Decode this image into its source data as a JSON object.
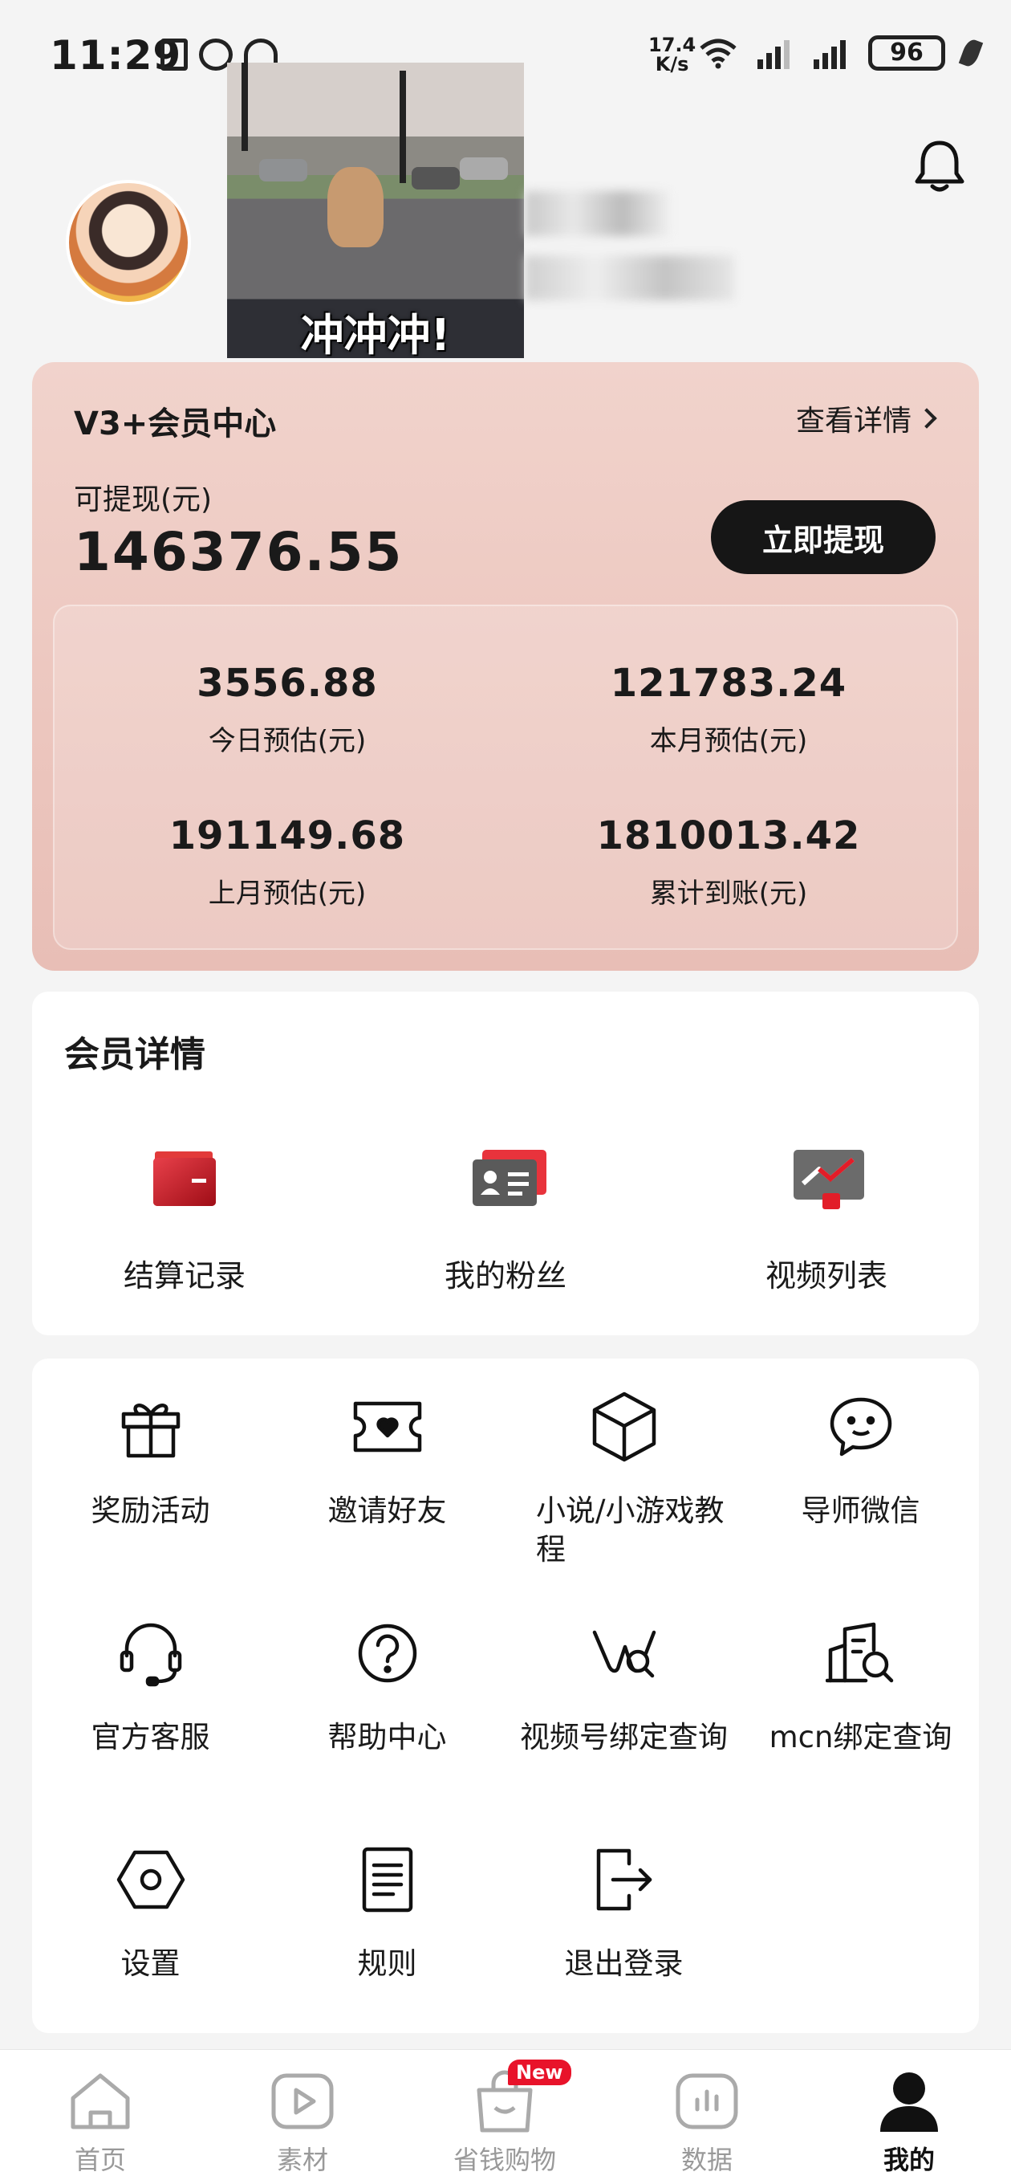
{
  "status_bar": {
    "time": "11:29",
    "net_speed_value": "17.4",
    "net_speed_unit": "K/s",
    "battery": "96"
  },
  "header": {
    "gif_caption": "冲冲冲!"
  },
  "vip": {
    "title": "V3+会员中心",
    "detail_link": "查看详情",
    "withdrawable_label": "可提现(元)",
    "withdrawable_amount": "146376.55",
    "withdraw_button": "立即提现",
    "stats": [
      {
        "value": "3556.88",
        "label": "今日预估(元)"
      },
      {
        "value": "121783.24",
        "label": "本月预估(元)"
      },
      {
        "value": "191149.68",
        "label": "上月预估(元)"
      },
      {
        "value": "1810013.42",
        "label": "累计到账(元)"
      }
    ]
  },
  "member_details": {
    "heading": "会员详情",
    "items": [
      {
        "label": "结算记录",
        "icon": "wallet-icon"
      },
      {
        "label": "我的粉丝",
        "icon": "id-card-icon"
      },
      {
        "label": "视频列表",
        "icon": "trend-chart-icon"
      }
    ]
  },
  "grid": {
    "items": [
      {
        "label": "奖励活动",
        "icon": "gift-icon"
      },
      {
        "label": "邀请好友",
        "icon": "ticket-heart-icon"
      },
      {
        "label": "小说/小游戏教程",
        "icon": "box-icon"
      },
      {
        "label": "导师微信",
        "icon": "chat-bubble-icon"
      },
      {
        "label": "官方客服",
        "icon": "headset-icon"
      },
      {
        "label": "帮助中心",
        "icon": "help-icon"
      },
      {
        "label": "视频号绑定查询",
        "icon": "channels-search-icon"
      },
      {
        "label": "mcn绑定查询",
        "icon": "building-search-icon"
      },
      {
        "label": "设置",
        "icon": "settings-hex-icon"
      },
      {
        "label": "规则",
        "icon": "document-icon"
      },
      {
        "label": "退出登录",
        "icon": "logout-icon"
      }
    ]
  },
  "bottom_nav": {
    "items": [
      {
        "label": "首页",
        "icon": "home-icon"
      },
      {
        "label": "素材",
        "icon": "play-icon"
      },
      {
        "label": "省钱购物",
        "icon": "shopping-bag-icon",
        "badge": "New"
      },
      {
        "label": "数据",
        "icon": "bar-chart-icon"
      },
      {
        "label": "我的",
        "icon": "person-icon",
        "active": true
      }
    ]
  },
  "colors": {
    "vip_card_bg": "#ecc6be",
    "accent_red": "#e8132a",
    "dark_button": "#161616"
  }
}
